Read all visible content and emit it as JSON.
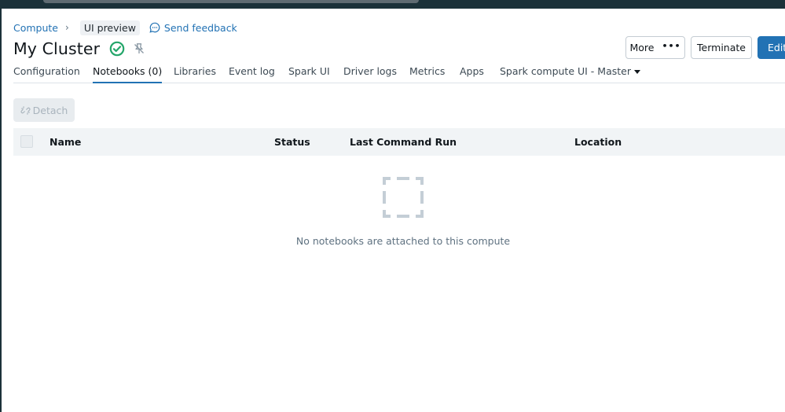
{
  "breadcrumb": {
    "parent": "Compute",
    "separator": "›",
    "tag": "UI preview",
    "feedback": "Send feedback"
  },
  "cluster": {
    "title": "My Cluster",
    "status_icon": "check-circle-icon",
    "status_color": "#24a66a"
  },
  "actions": {
    "more": "More",
    "more_dots": "•••",
    "terminate": "Terminate",
    "edit": "Edit"
  },
  "tabs": [
    {
      "label": "Configuration"
    },
    {
      "label": "Notebooks (0)",
      "active": true
    },
    {
      "label": "Libraries"
    },
    {
      "label": "Event log"
    },
    {
      "label": "Spark UI"
    },
    {
      "label": "Driver logs"
    },
    {
      "label": "Metrics"
    },
    {
      "label": "Apps"
    },
    {
      "label": "Spark compute UI - Master"
    }
  ],
  "toolbar": {
    "detach": "Detach"
  },
  "table": {
    "columns": [
      "Name",
      "Status",
      "Last Command Run",
      "Location"
    ],
    "rows": [],
    "empty_message": "No notebooks are attached to this compute"
  },
  "colors": {
    "accent": "#2272b4",
    "topbar": "#1b3139"
  }
}
